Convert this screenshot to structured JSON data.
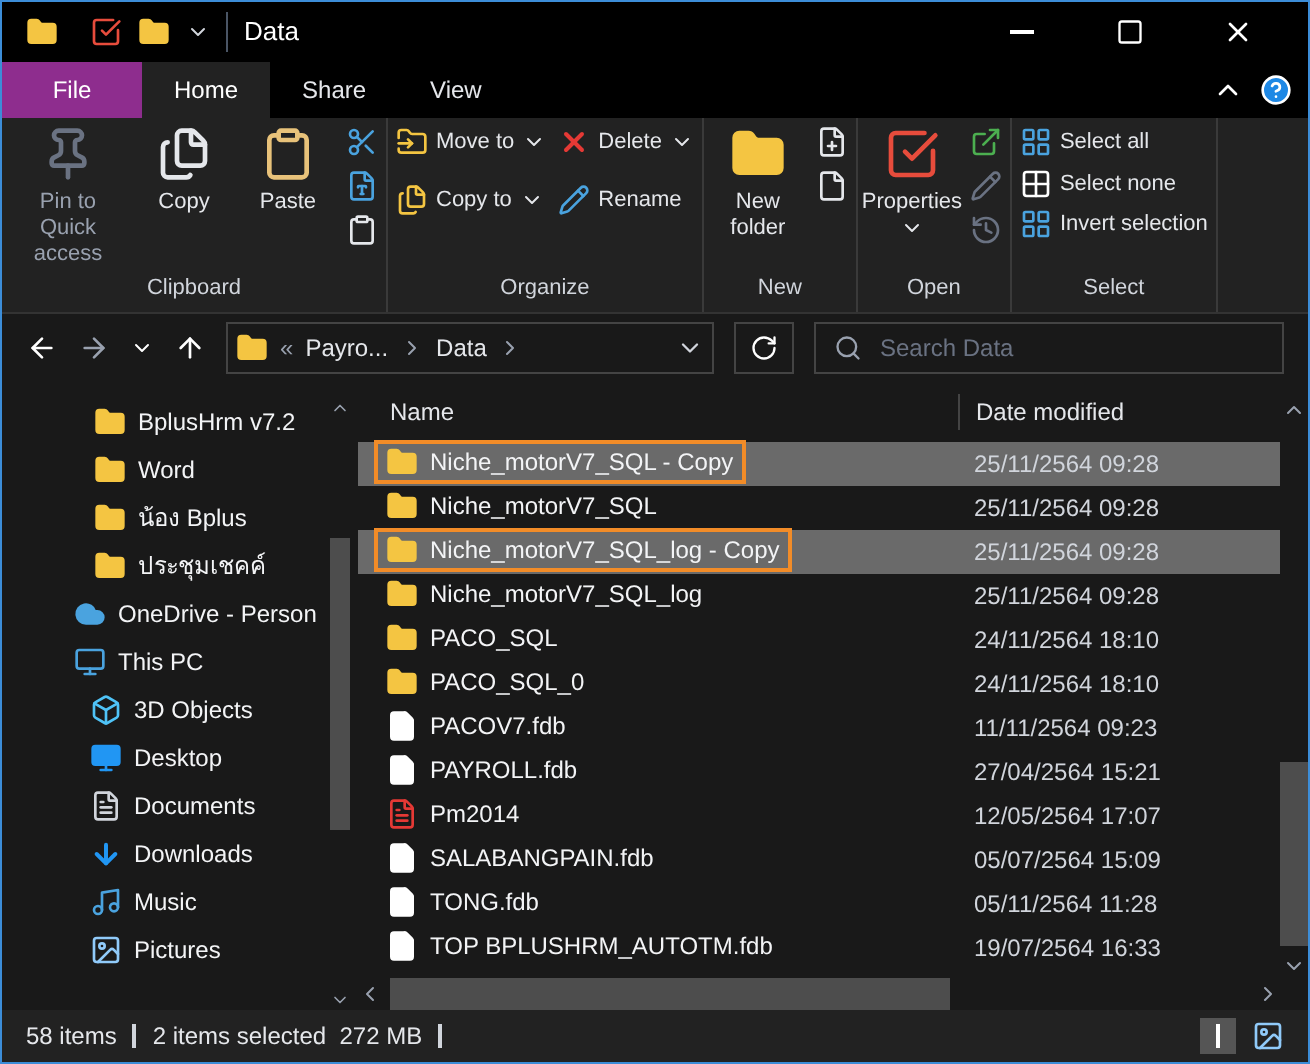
{
  "window": {
    "title": "Data"
  },
  "tabs": [
    {
      "label": "File",
      "kind": "file",
      "selected": false
    },
    {
      "label": "Home",
      "kind": "tab",
      "selected": true
    },
    {
      "label": "Share",
      "kind": "tab",
      "selected": false
    },
    {
      "label": "View",
      "kind": "tab",
      "selected": false
    }
  ],
  "ribbon": [
    {
      "label": "Clipboard",
      "items": [
        {
          "kind": "big",
          "label": "Pin to Quick access",
          "disabled": true,
          "caret": false
        },
        {
          "kind": "big",
          "label": "Copy",
          "disabled": false,
          "caret": false
        },
        {
          "kind": "big",
          "label": "Paste",
          "disabled": false,
          "caret": false
        },
        {
          "kind": "mini"
        }
      ]
    },
    {
      "label": "Organize",
      "items": [
        {
          "kind": "pair",
          "rows": [
            {
              "label": "Move to",
              "caret": true
            },
            {
              "label": "Copy to",
              "caret": true
            }
          ]
        },
        {
          "kind": "pair",
          "rows": [
            {
              "label": "Delete",
              "caret": true
            },
            {
              "label": "Rename",
              "caret": false
            }
          ]
        }
      ]
    },
    {
      "label": "New",
      "items": [
        {
          "kind": "big",
          "label": "New folder",
          "disabled": false,
          "caret": false
        },
        {
          "kind": "mini"
        }
      ]
    },
    {
      "label": "Open",
      "items": [
        {
          "kind": "big",
          "label": "Properties",
          "disabled": false,
          "caret": true
        },
        {
          "kind": "mini"
        }
      ]
    },
    {
      "label": "Select",
      "items": [
        {
          "kind": "pair",
          "rows": [
            {
              "label": "Select all",
              "caret": false
            },
            {
              "label": "Select none",
              "caret": false
            },
            {
              "label": "Invert selection",
              "caret": false
            }
          ]
        }
      ]
    }
  ],
  "address": {
    "overflow": "«",
    "path": [
      "Payro...",
      "Data"
    ],
    "search_placeholder": "Search Data"
  },
  "nav": [
    {
      "label": "BplusHrm v7.2",
      "kind": "folder"
    },
    {
      "label": "Word",
      "kind": "folder"
    },
    {
      "label": "น้อง Bplus",
      "kind": "folder"
    },
    {
      "label": "ประชุมเชคค์",
      "kind": "folder"
    },
    {
      "label": "OneDrive - Person",
      "kind": "cloud"
    },
    {
      "label": "This PC",
      "kind": "pc",
      "children": [
        {
          "label": "3D Objects",
          "kind": "cube"
        },
        {
          "label": "Desktop",
          "kind": "desktop"
        },
        {
          "label": "Documents",
          "kind": "documents"
        },
        {
          "label": "Downloads",
          "kind": "downloads"
        },
        {
          "label": "Music",
          "kind": "music"
        },
        {
          "label": "Pictures",
          "kind": "pictures"
        }
      ]
    }
  ],
  "table": {
    "columns": [
      "Name",
      "Date modified"
    ],
    "rows": [
      {
        "name": "Niche_motorV7_SQL - Copy",
        "date": "25/11/2564 09:28",
        "kind": "dbfolder",
        "selected": true,
        "outlined": true
      },
      {
        "name": "Niche_motorV7_SQL",
        "date": "25/11/2564 09:28",
        "kind": "dbfolder",
        "selected": false,
        "outlined": false
      },
      {
        "name": "Niche_motorV7_SQL_log - Copy",
        "date": "25/11/2564 09:28",
        "kind": "dbfolder",
        "selected": true,
        "outlined": true
      },
      {
        "name": "Niche_motorV7_SQL_log",
        "date": "25/11/2564 09:28",
        "kind": "dbfolder",
        "selected": false,
        "outlined": false
      },
      {
        "name": "PACO_SQL",
        "date": "24/11/2564 18:10",
        "kind": "dbfolder",
        "selected": false,
        "outlined": false
      },
      {
        "name": "PACO_SQL_0",
        "date": "24/11/2564 18:10",
        "kind": "dbfolder",
        "selected": false,
        "outlined": false
      },
      {
        "name": "PACOV7.fdb",
        "date": "11/11/2564 09:23",
        "kind": "file",
        "selected": false,
        "outlined": false
      },
      {
        "name": "PAYROLL.fdb",
        "date": "27/04/2564 15:21",
        "kind": "file",
        "selected": false,
        "outlined": false
      },
      {
        "name": "Pm2014",
        "date": "12/05/2564 17:07",
        "kind": "pdf",
        "selected": false,
        "outlined": false
      },
      {
        "name": "SALABANGPAIN.fdb",
        "date": "05/07/2564 15:09",
        "kind": "file",
        "selected": false,
        "outlined": false
      },
      {
        "name": "TONG.fdb",
        "date": "05/11/2564 11:28",
        "kind": "file",
        "selected": false,
        "outlined": false
      },
      {
        "name": "TOP BPLUSHRM_AUTOTM.fdb",
        "date": "19/07/2564 16:33",
        "kind": "file",
        "selected": false,
        "outlined": false
      }
    ]
  },
  "status_bar": {
    "items": "58 items",
    "selection": "2 items selected  272 MB"
  }
}
